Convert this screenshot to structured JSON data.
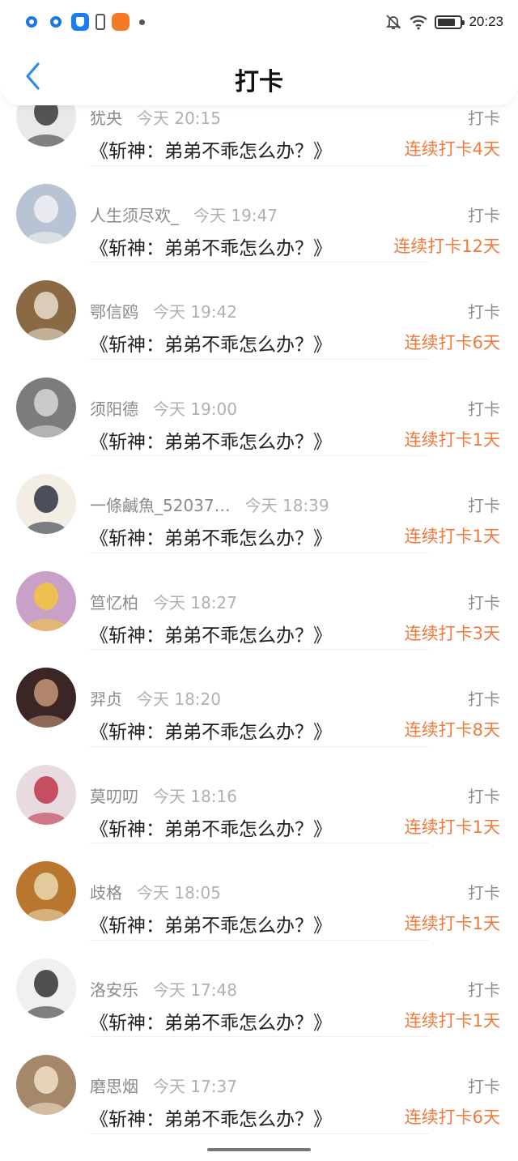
{
  "status_bar": {
    "time": "20:23",
    "left_icons": [
      "q-app-icon",
      "q-app-icon",
      "shield-app-icon",
      "battery-alert-icon",
      "orange-app-icon",
      "dot-icon"
    ],
    "right_icons": [
      "mute-bell-icon",
      "wifi-icon",
      "battery-icon"
    ]
  },
  "header": {
    "title": "打卡",
    "back_icon": "chevron-left-icon",
    "accent": "#2f8ae5"
  },
  "colors": {
    "streak": "#f07a3c",
    "meta": "#8e8e8e",
    "text": "#222222"
  },
  "checkins": [
    {
      "name": "犹央",
      "time": "今天 20:15",
      "book": "《斩神：弟弟不乖怎么办？》",
      "type": "打卡",
      "streak": "连续打卡4天",
      "avatar_bg": "#e9e9e9",
      "avatar_fg": "#3a3a3a"
    },
    {
      "name": "人生须尽欢_",
      "time": "今天 19:47",
      "book": "《斩神：弟弟不乖怎么办？》",
      "type": "打卡",
      "streak": "连续打卡12天",
      "avatar_bg": "#b8c3d3",
      "avatar_fg": "#f1f1f4"
    },
    {
      "name": "鄂信鸥",
      "time": "今天 19:42",
      "book": "《斩神：弟弟不乖怎么办？》",
      "type": "打卡",
      "streak": "连续打卡6天",
      "avatar_bg": "#8a6a44",
      "avatar_fg": "#e9ddcc"
    },
    {
      "name": "须阳德",
      "time": "今天 19:00",
      "book": "《斩神：弟弟不乖怎么办？》",
      "type": "打卡",
      "streak": "连续打卡1天",
      "avatar_bg": "#7c7c7c",
      "avatar_fg": "#d8d8d8"
    },
    {
      "name": "一條鹹魚_52037…",
      "time": "今天 18:39",
      "book": "《斩神：弟弟不乖怎么办？》",
      "type": "打卡",
      "streak": "连续打卡1天",
      "avatar_bg": "#f3ede6",
      "avatar_fg": "#2b3340"
    },
    {
      "name": "笪忆柏",
      "time": "今天 18:27",
      "book": "《斩神：弟弟不乖怎么办？》",
      "type": "打卡",
      "streak": "连续打卡3天",
      "avatar_bg": "#c9a0c8",
      "avatar_fg": "#f5c43c"
    },
    {
      "name": "羿贞",
      "time": "今天 18:20",
      "book": "《斩神：弟弟不乖怎么办？》",
      "type": "打卡",
      "streak": "连续打卡8天",
      "avatar_bg": "#3a2624",
      "avatar_fg": "#c59779"
    },
    {
      "name": "莫叨叨",
      "time": "今天 18:16",
      "book": "《斩神：弟弟不乖怎么办？》",
      "type": "打卡",
      "streak": "连续打卡1天",
      "avatar_bg": "#e8dbe0",
      "avatar_fg": "#c0354a"
    },
    {
      "name": "歧格",
      "time": "今天 18:05",
      "book": "《斩神：弟弟不乖怎么办？》",
      "type": "打卡",
      "streak": "连续打卡1天",
      "avatar_bg": "#b8762f",
      "avatar_fg": "#e9d9b0"
    },
    {
      "name": "洛安乐",
      "time": "今天 17:48",
      "book": "《斩神：弟弟不乖怎么办？》",
      "type": "打卡",
      "streak": "连续打卡1天",
      "avatar_bg": "#f0f0f0",
      "avatar_fg": "#333333"
    },
    {
      "name": "磨思烟",
      "time": "今天 17:37",
      "book": "《斩神：弟弟不乖怎么办？》",
      "type": "打卡",
      "streak": "连续打卡6天",
      "avatar_bg": "#a5876a",
      "avatar_fg": "#f1e1c8"
    }
  ]
}
